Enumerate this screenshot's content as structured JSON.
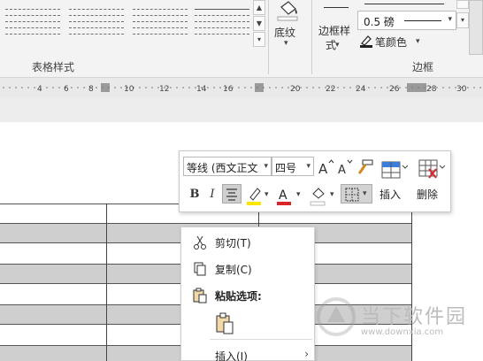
{
  "ribbon": {
    "table_styles_group_label": "表格样式",
    "shading_label": "底纹",
    "border_styles_label_line1": "边框样",
    "border_styles_label_line2": "式",
    "pen_weight": "0.5 磅",
    "pen_color_label": "笔颜色",
    "borders_group_label": "边框",
    "accent_color": "#e07a1f"
  },
  "ruler": {
    "labels": [
      "4",
      "6",
      "8",
      "10",
      "12",
      "14",
      "16",
      "20",
      "22",
      "24",
      "26",
      "28",
      "30"
    ]
  },
  "mini_toolbar": {
    "font_name": "等线 (西文正文",
    "font_size": "四号",
    "bold_label": "B",
    "italic_label": "I",
    "font_color": "#d9262c",
    "highlight_color": "#ffe600",
    "insert_label": "插入",
    "delete_label": "删除"
  },
  "context_menu": {
    "items": [
      {
        "label": "剪切(T)",
        "icon": "scissors-icon"
      },
      {
        "label": "复制(C)",
        "icon": "copy-icon"
      },
      {
        "label": "粘贴选项:",
        "icon": "paste-icon"
      },
      {
        "label": "插入(I)",
        "icon": "insert-icon"
      }
    ]
  },
  "watermark": {
    "text": "当下软件园",
    "url": "www.downxia.com"
  }
}
